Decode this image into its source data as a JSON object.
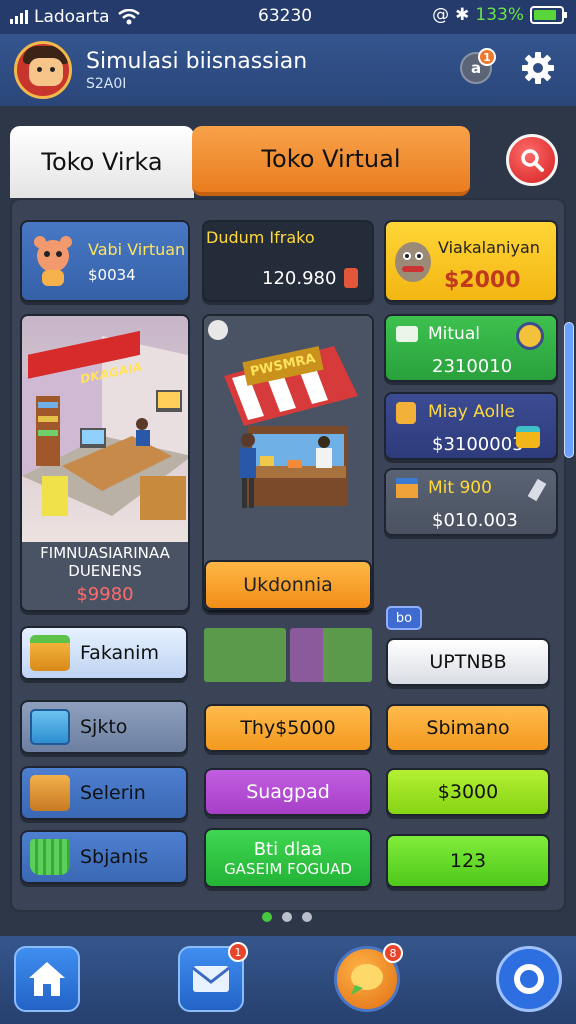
{
  "status_bar": {
    "carrier": "Ladoarta",
    "time": "63230",
    "battery_text": "133%",
    "battery_level": 0.85,
    "colors": {
      "battery": "#58d63a"
    }
  },
  "header": {
    "title": "Simulasi biisnassian",
    "subtitle": "S2A0I",
    "badge_letter": "a",
    "badge_count": "1"
  },
  "tabs": [
    {
      "label": "Toko Virka",
      "active": false
    },
    {
      "label": "Toko Virtual",
      "active": true
    }
  ],
  "cards_top": [
    {
      "label": "Vabi Virtuan",
      "value": "$0034",
      "color": "#4878c4"
    },
    {
      "label": "Dudum Ifrako",
      "value": "120.980",
      "color": "#252c39"
    },
    {
      "label": "Viakalaniyan",
      "value": "$2000",
      "color": "#ffd637"
    }
  ],
  "feature_left": {
    "sign": "DKAGAIA",
    "line1": "FIMNUASIARINAA",
    "line2": "DUENENS",
    "price": "$9980"
  },
  "feature_mid": {
    "sign": "PWSMRA",
    "button": "Ukdonnia"
  },
  "right_cards": [
    {
      "label": "Mitual",
      "value": "2310010",
      "color": "#3ec14f"
    },
    {
      "label": "Miay Aolle",
      "value": "$3100003",
      "color": "#3c4c93"
    },
    {
      "label": "Mit 900",
      "value": "$010.003",
      "color": "#5a6373"
    }
  ],
  "small_tag": "bo",
  "left_menu": [
    {
      "label": "Fakanim",
      "icon": "box-icon"
    },
    {
      "label": "Sjkto",
      "icon": "crate-icon"
    },
    {
      "label": "Selerin",
      "icon": "package-icon"
    },
    {
      "label": "Sbjanis",
      "icon": "basket-icon"
    }
  ],
  "mid_buttons": [
    {
      "label": "Thy$5000"
    },
    {
      "label": "Suagpad"
    },
    {
      "label": "Bti dlaa",
      "sub": "GASEIM FOGUAD"
    }
  ],
  "right_buttons": [
    {
      "label": "UPTNBB"
    },
    {
      "label": "Sbimano"
    },
    {
      "label": "$3000"
    },
    {
      "label": "123"
    }
  ],
  "bottom_nav": {
    "mail_badge": "1",
    "chat_badge": "8"
  }
}
